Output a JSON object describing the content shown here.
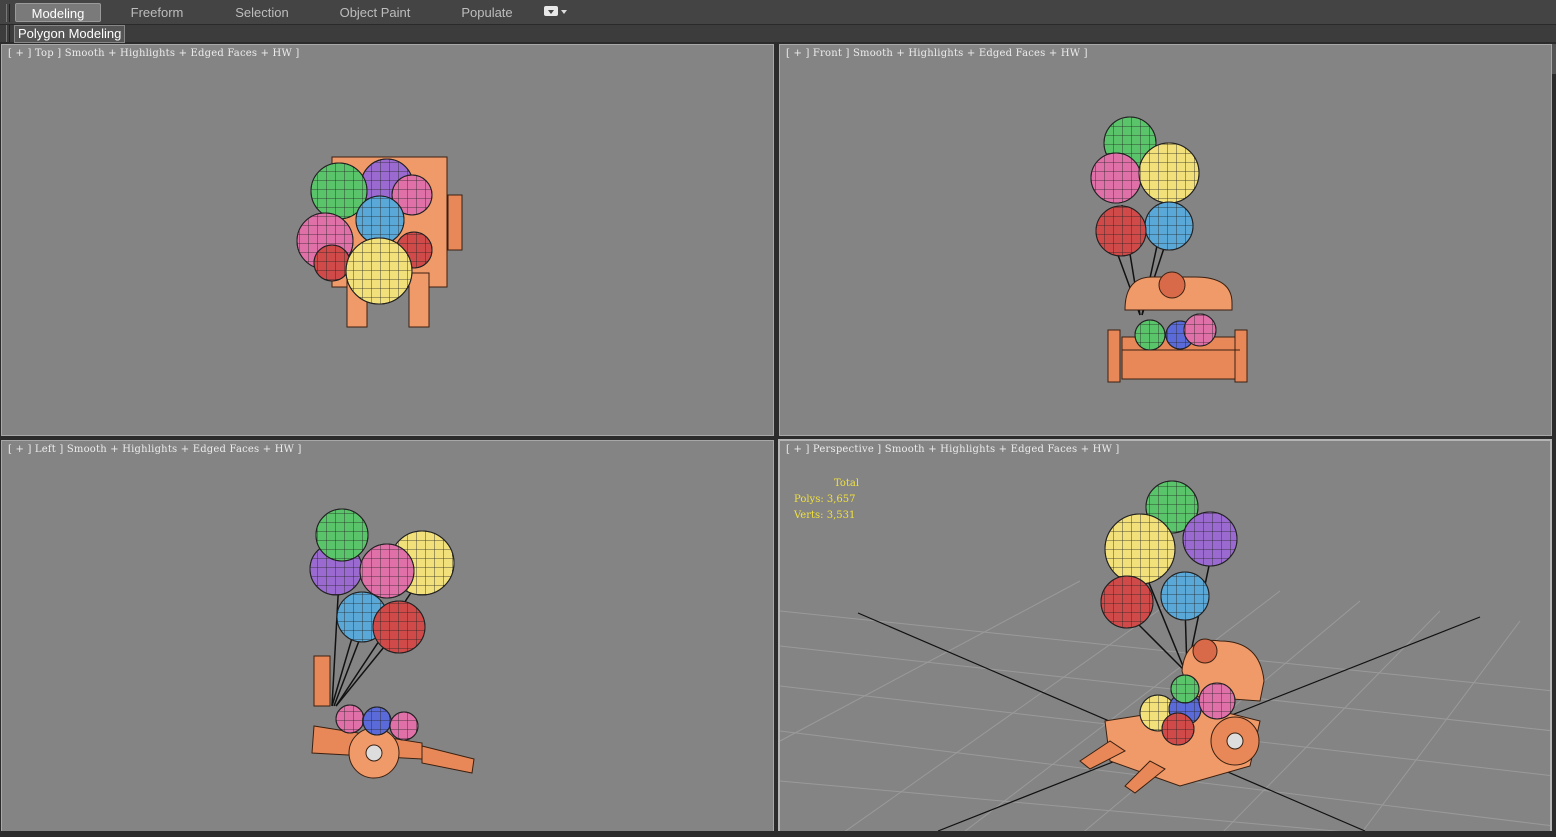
{
  "ribbon": {
    "tabs": [
      {
        "label": "Modeling",
        "active": true
      },
      {
        "label": "Freeform",
        "active": false
      },
      {
        "label": "Selection",
        "active": false
      },
      {
        "label": "Object Paint",
        "active": false
      },
      {
        "label": "Populate",
        "active": false
      }
    ],
    "panel_label": "Polygon Modeling",
    "options_icon": "dropdown-icon"
  },
  "viewports": {
    "top": {
      "label": "[ + ] Top ] Smooth + Highlights + Edged Faces + HW ]"
    },
    "front": {
      "label": "[ + ] Front ] Smooth + Highlights + Edged Faces + HW ]"
    },
    "left": {
      "label": "[ + ] Left ] Smooth + Highlights + Edged Faces + HW ]"
    },
    "perspective": {
      "label": "[ + ] Perspective ] Smooth + Highlights + Edged Faces + HW ]",
      "stats": {
        "header": "Total",
        "polys": "Polys: 3,657",
        "verts": "Verts: 3,531"
      }
    }
  },
  "colors": {
    "viewport_bg": "#848484",
    "cart": "#f09a6a",
    "balloon_green": "#5ac46a",
    "balloon_yellow": "#f2e07a",
    "balloon_pink": "#e070a8",
    "balloon_purple": "#9a6ad0",
    "balloon_blue": "#5aa8d8",
    "balloon_red": "#d04a4a",
    "stats_text": "#f0e040"
  }
}
